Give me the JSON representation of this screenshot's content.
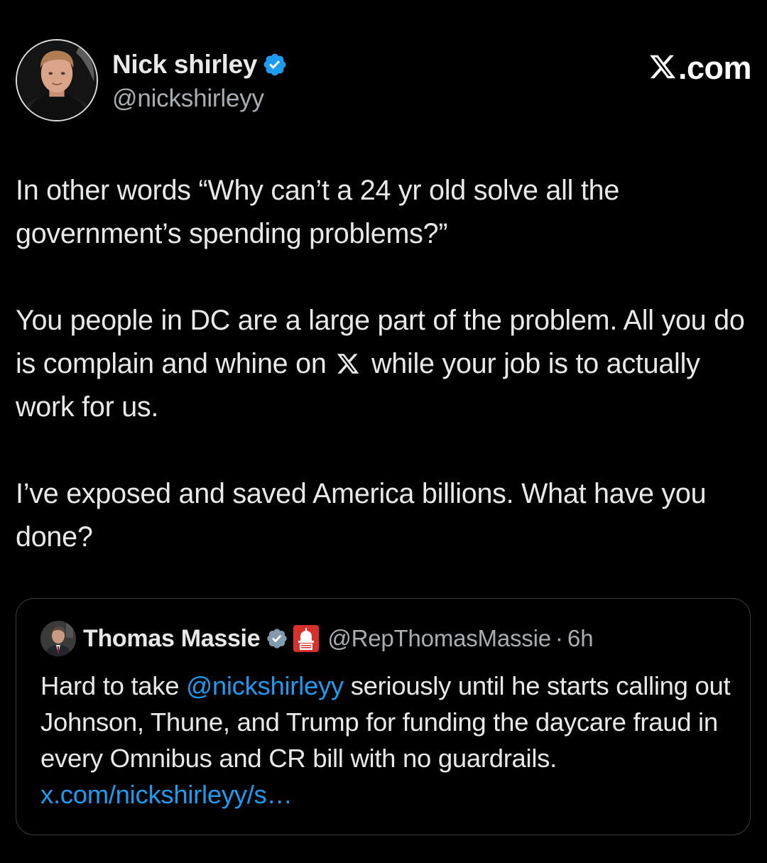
{
  "author": {
    "display_name": "Nick shirley",
    "handle": "@nickshirleyy",
    "verified": true,
    "avatar": "profile-photo"
  },
  "brand": {
    "logo": "x-logo-icon",
    "text": ".com"
  },
  "tweet": {
    "paragraphs": [
      "In other words “Why can’t a 24 yr old solve all the government’s spending problems?”",
      {
        "before": "You people in DC are a large part of the problem. All you do is complain and whine on",
        "after": "while your job is to actually work for us."
      },
      "I’ve exposed and saved America billions. What have you done?"
    ]
  },
  "quote": {
    "display_name": "Thomas Massie",
    "verified": true,
    "affiliation_badge": "house-gop-icon",
    "handle": "@RepThomasMassie",
    "separator": "·",
    "time": "6h",
    "text_before_mention": "Hard to take",
    "mention": "@nickshirleyy",
    "text_after_mention": "seriously until he starts calling out Johnson, Thune, and Trump for funding the daycare fraud in every Omnibus and CR bill with no guardrails.",
    "link": "x.com/nickshirleyy/s…"
  },
  "colors": {
    "background": "#000000",
    "text": "#e7e9ea",
    "secondary_text": "#a7adb2",
    "link": "#1d9bf0",
    "verified_badge": "#1d9bf0",
    "quote_border": "#3a3d40"
  }
}
